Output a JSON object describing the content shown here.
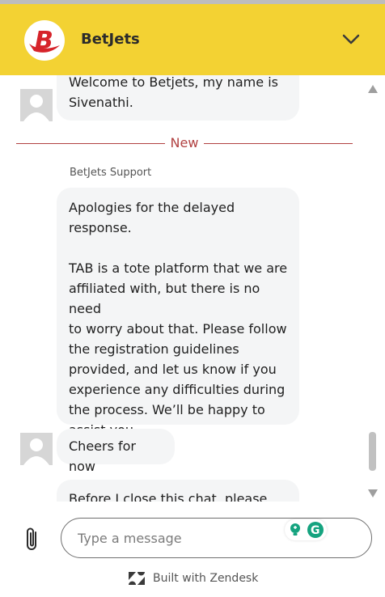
{
  "header": {
    "brand": "BetJets",
    "logo_letter": "B"
  },
  "messages": {
    "welcome_line1": "Welcome to Betjets, my name is",
    "welcome_line2": "Sivenathi.",
    "new_label": "New",
    "sender": "BetJets Support",
    "apology_lines": [
      "Apologies for the delayed",
      "response."
    ],
    "tab_lines": [
      "TAB is a tote platform that we are",
      "affiliated with, but there is no need",
      "to worry about that. Please follow",
      "the registration guidelines",
      "provided, and let us know if you",
      "experience any difficulties during",
      "the process. We’ll be happy to",
      "assist you."
    ],
    "cheers": "Cheers for now",
    "closing_partial": "Before I close this chat, please take"
  },
  "composer": {
    "placeholder": "Type a message"
  },
  "footer": {
    "built_with": "Built with Zendesk"
  },
  "colors": {
    "header_bg": "#f3d233",
    "new_separator": "#b14141",
    "bubble_bg": "#f4f5f6",
    "logo_red": "#d6232a"
  },
  "icons": [
    "betjets-logo",
    "chevron-down-icon",
    "avatar-placeholder-icon",
    "paperclip-icon",
    "lightbulb-icon",
    "grammarly-icon",
    "zendesk-logo-icon"
  ]
}
